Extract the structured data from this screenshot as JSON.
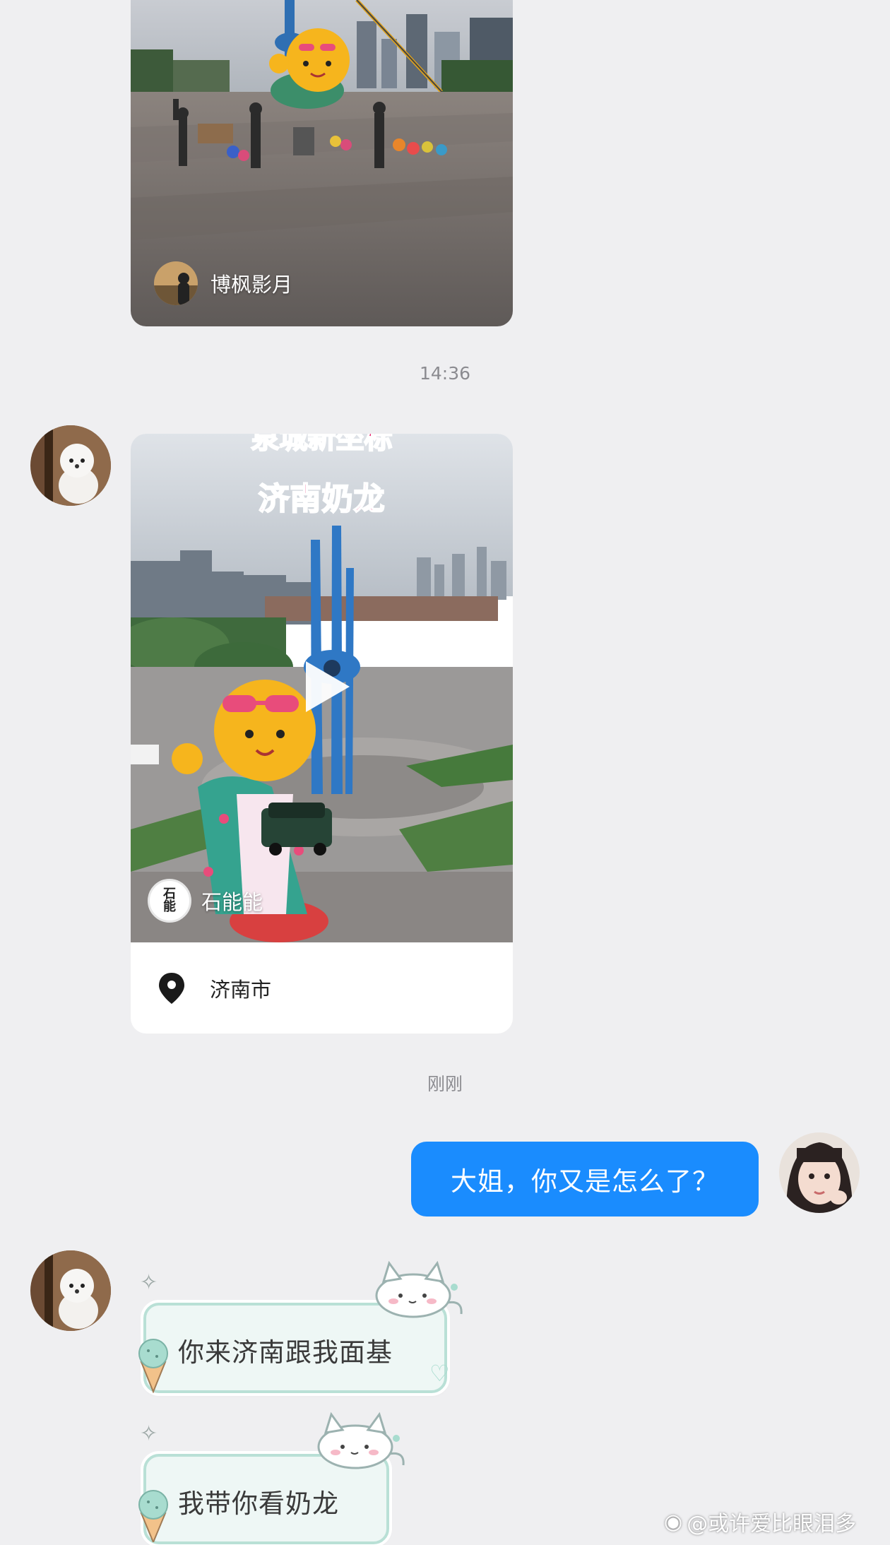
{
  "messages": {
    "top_post": {
      "author": "博枫影月"
    },
    "time_1": "14:36",
    "video_post": {
      "headline_partial": "泉城新坐标",
      "headline": "济南奶龙",
      "author": "石能能",
      "author_logo_text": "石能",
      "location": "济南市"
    },
    "time_2": "刚刚",
    "outgoing_text": "大姐，你又是怎么了？",
    "incoming_1": "你来济南跟我面基",
    "incoming_2": "我带你看奶龙"
  },
  "watermark": "@或许爱比眼泪多",
  "colors": {
    "background": "#efeff1",
    "outgoing_bubble": "#1a8cfe",
    "headline_pink": "#e8246e",
    "sticker_border": "#b9e0d6"
  }
}
